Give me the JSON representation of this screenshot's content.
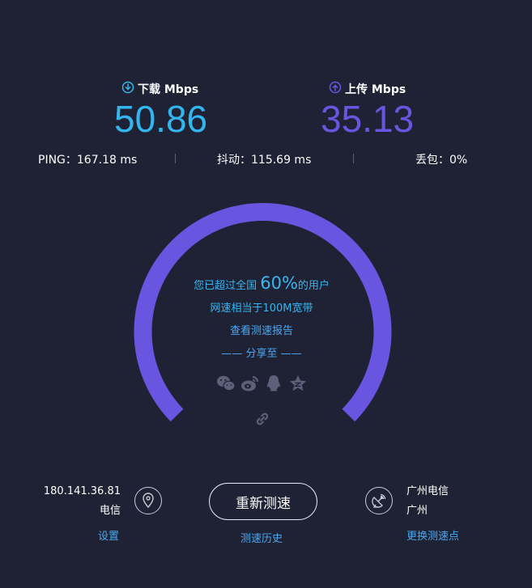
{
  "download": {
    "label": "下载 Mbps",
    "value": "50.86",
    "color": "#33b6f0"
  },
  "upload": {
    "label": "上传 Mbps",
    "value": "35.13",
    "color": "#6a55e0"
  },
  "stats": {
    "ping": "PING：167.18 ms",
    "jitter": "抖动：115.69 ms",
    "loss": "丢包：0%"
  },
  "gauge": {
    "line1_prefix": "您已超过全国",
    "percent": "60%",
    "line1_suffix": "的用户",
    "line2": "网速相当于100M宽带",
    "report_link": "查看测速报告",
    "share_label": "—— 分享至 ——",
    "share_icons": [
      "wechat-icon",
      "weibo-icon",
      "qq-icon",
      "qzone-icon",
      "link-icon"
    ],
    "arc_color": "#6a55e0"
  },
  "client": {
    "ip": "180.141.36.81",
    "isp": "电信",
    "settings_link": "设置"
  },
  "action": {
    "retest_label": "重新测速",
    "history_link": "测速历史"
  },
  "server": {
    "isp": "广州电信",
    "city": "广州",
    "change_link": "更换测速点"
  }
}
